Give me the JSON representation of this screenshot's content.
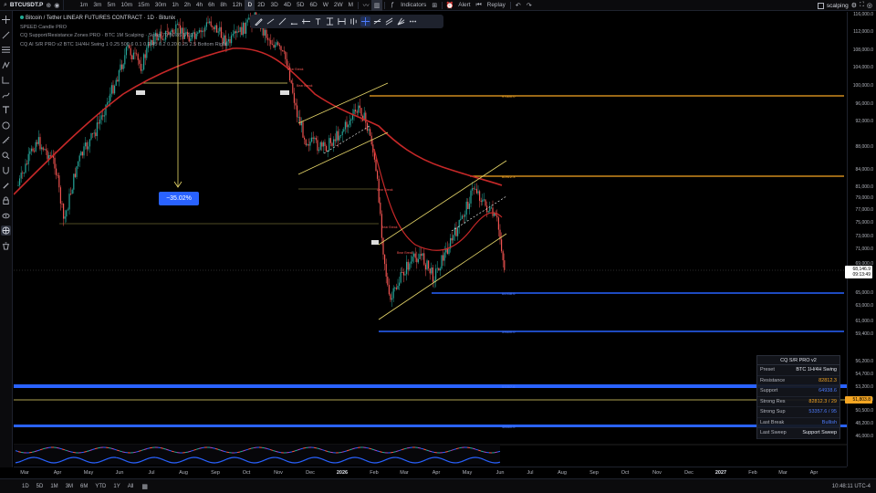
{
  "toolbar": {
    "symbol": "BTCUSDT.P",
    "timeframes": [
      "1m",
      "3m",
      "5m",
      "10m",
      "15m",
      "30m",
      "1h",
      "2h",
      "4h",
      "6h",
      "8h",
      "12h",
      "D",
      "2D",
      "3D",
      "4D",
      "5D",
      "6D",
      "W",
      "2W",
      "M"
    ],
    "active_timeframe": "D",
    "indicators_label": "Indicators",
    "alert_label": "Alert",
    "replay_label": "Replay",
    "layout_name": "scalping"
  },
  "legend": {
    "title": "Bitcoin / Tether LINEAR FUTURES CONTRACT · 1D · Bitunix",
    "line2": "SPEED Candle PRO",
    "line3": "CQ Support/Resistance Zones PRO · BTC 1M Scalping · Swap 70 80 85 5 13",
    "line4": "CQ AI S/R PRO v2 BTC 1H/4H Swing 1 0.25 500 6 0.1 0.2 45 0.2 0.20 0.25 2.5 Bottom Right"
  },
  "measure": {
    "label": "−35.02%"
  },
  "sr_table": {
    "title": "CQ S/R PRO v2",
    "rows": [
      {
        "k": "Preset",
        "v": "BTC 1H/4H Swing"
      },
      {
        "k": "Resistance",
        "v": "82812.3"
      },
      {
        "k": "Support",
        "v": "64938.6"
      },
      {
        "k": "Strong Res",
        "v": "82812.3 / 29"
      },
      {
        "k": "Strong Sup",
        "v": "53357.6 / 95"
      },
      {
        "k": "Last Break",
        "v": "Bullish"
      },
      {
        "k": "Last Sweep",
        "v": "Support Sweep"
      }
    ]
  },
  "price_axis": {
    "labels": [
      "116,000.0",
      "112,000.0",
      "108,000.0",
      "104,000.0",
      "100,000.0",
      "96,000.0",
      "92,000.0",
      "88,000.0",
      "84,000.0",
      "81,000.0",
      "79,000.0",
      "77,000.0",
      "75,000.0",
      "73,000.0",
      "71,000.0",
      "69,000.0",
      "65,000.0",
      "63,000.0",
      "61,000.0",
      "59,400.0",
      "56,200.0",
      "54,700.0",
      "53,200.0",
      "51,800.0",
      "50,500.0",
      "48,200.0",
      "46,000.0"
    ],
    "current_price": "68,146.9",
    "countdown": "09:13:49",
    "strong_sup_tag": "51,803.8"
  },
  "time_axis": {
    "labels": [
      "Mar",
      "Apr",
      "May",
      "Jun",
      "Jul",
      "Aug",
      "Sep",
      "Oct",
      "Nov",
      "Dec",
      "2026",
      "Feb",
      "Mar",
      "Apr",
      "May",
      "Jun",
      "Jul",
      "Aug",
      "Sep",
      "Oct",
      "Nov",
      "Dec",
      "2027",
      "Feb",
      "Mar",
      "Apr"
    ],
    "bold": [
      "2026",
      "2027"
    ]
  },
  "level_labels": {
    "res1": "97600.0",
    "res2": "82812.3",
    "sup1": "64938.6",
    "sup2": "59600.0",
    "sup3": "53357.6",
    "sup4": "48660.0",
    "bear_break": "Bear Break"
  },
  "bottom": {
    "ranges": [
      "1D",
      "5D",
      "1M",
      "3M",
      "6M",
      "YTD",
      "1Y",
      "All"
    ],
    "clock": "10:48:11 UTC-4"
  },
  "colors": {
    "bull": "#26a69a",
    "bear": "#ef5350",
    "ma": "#c62828",
    "res": "#f5a623",
    "sup": "#2962ff",
    "channel": "#e8d86a"
  }
}
